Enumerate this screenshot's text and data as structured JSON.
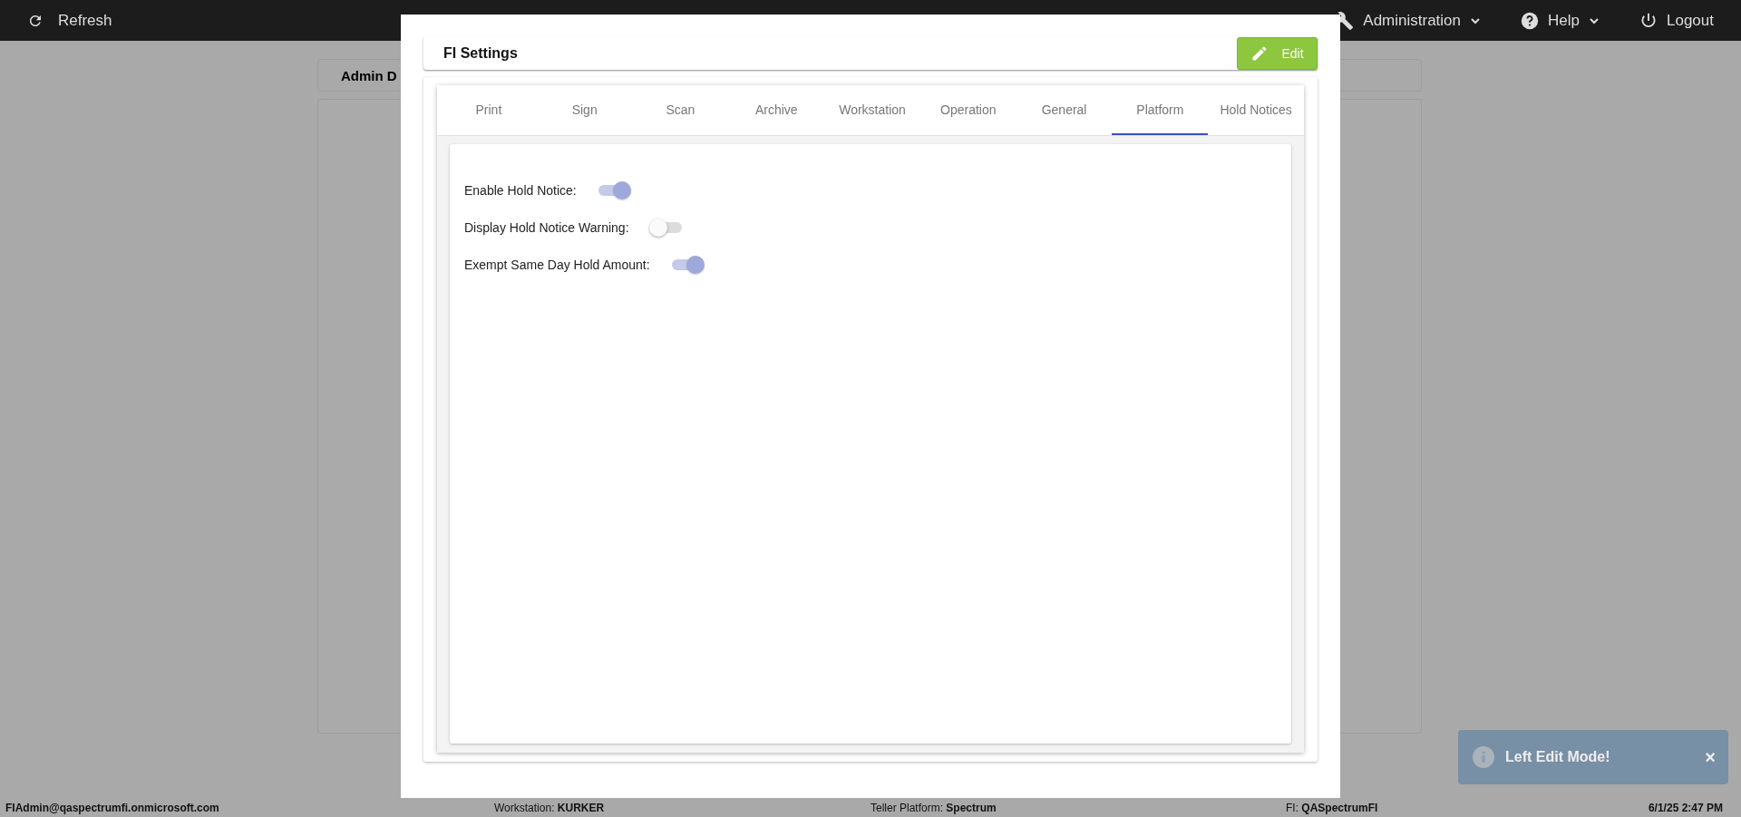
{
  "top_bar": {
    "refresh": "Refresh",
    "menus": [
      {
        "kind": "wrench",
        "label": "Administration",
        "dropdown": true
      },
      {
        "kind": "help",
        "label": "Help",
        "dropdown": true
      },
      {
        "kind": "power",
        "label": "Logout",
        "dropdown": false
      }
    ]
  },
  "background_card": {
    "title": "Admin D"
  },
  "modal": {
    "title": "FI Settings",
    "edit_button": "Edit",
    "tabs": [
      {
        "label": "Print",
        "selected": false
      },
      {
        "label": "Sign",
        "selected": false
      },
      {
        "label": "Scan",
        "selected": false
      },
      {
        "label": "Archive",
        "selected": false
      },
      {
        "label": "Workstation",
        "selected": false
      },
      {
        "label": "Operation",
        "selected": false
      },
      {
        "label": "General",
        "selected": false
      },
      {
        "label": "Platform",
        "selected": true
      },
      {
        "label": "Hold Notices",
        "selected": false
      }
    ],
    "settings": [
      {
        "label": "Enable Hold Notice:",
        "on": true
      },
      {
        "label": "Display Hold Notice Warning:",
        "on": false
      },
      {
        "label": "Exempt Same Day Hold Amount:",
        "on": true
      }
    ]
  },
  "toast": {
    "message": "Left Edit Mode!",
    "close": "×"
  },
  "status_bar": {
    "user": "FIAdmin@qaspectrumfi.onmicrosoft.com",
    "workstation": "Workstation: **KURKER**",
    "platform": "Teller Platform: **Spectrum**",
    "fi": "FI: **QASpectrumFI**",
    "time": "6/1/25 2:47 PM"
  }
}
